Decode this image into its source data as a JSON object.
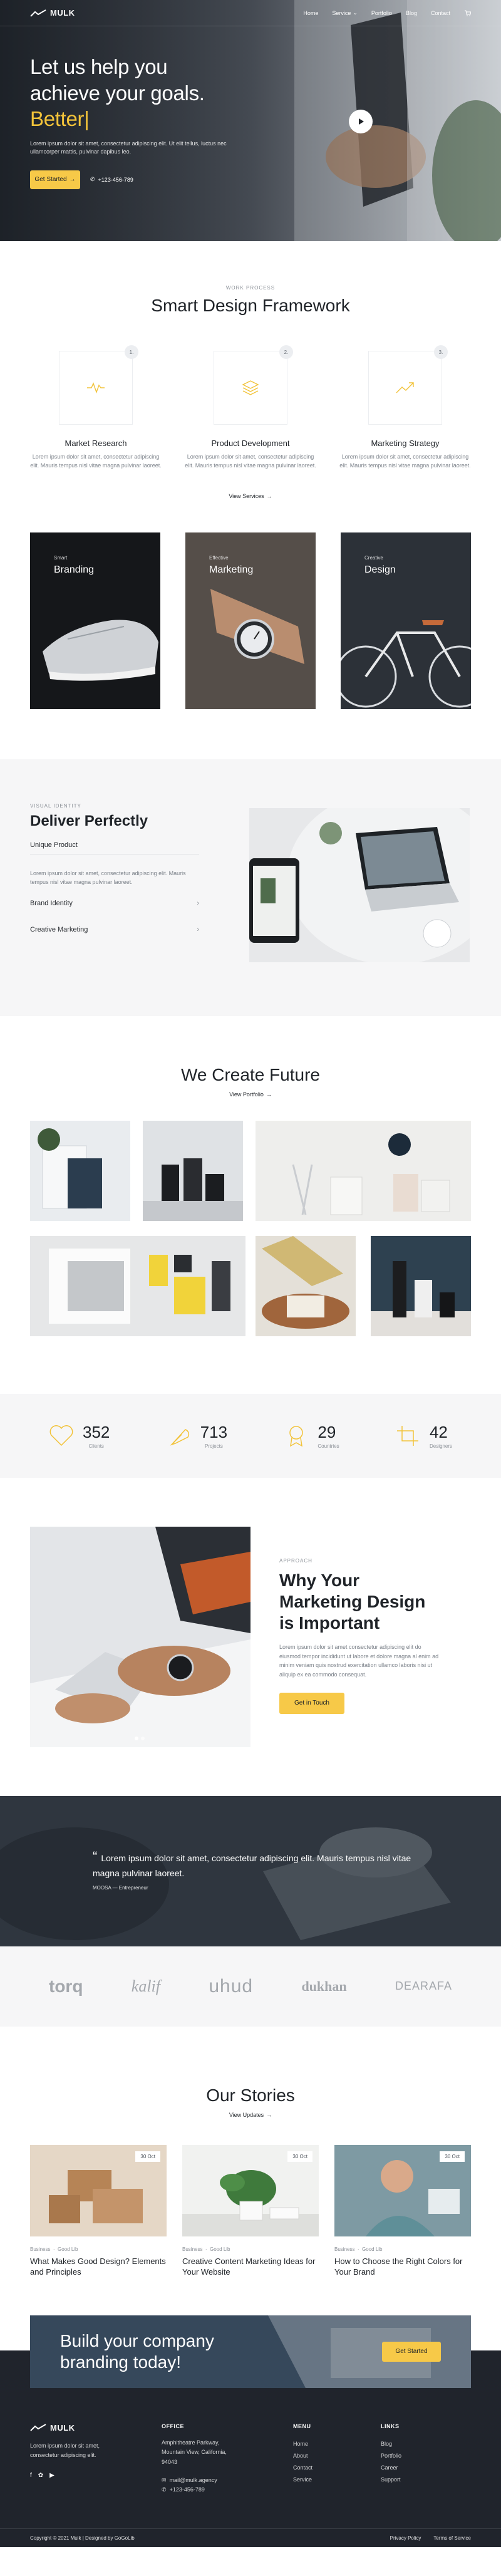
{
  "brand": {
    "name": "MULK"
  },
  "nav": {
    "items": [
      {
        "label": "Home",
        "dropdown": false
      },
      {
        "label": "Service",
        "dropdown": true
      },
      {
        "label": "Portfolio",
        "dropdown": false
      },
      {
        "label": "Blog",
        "dropdown": false
      },
      {
        "label": "Contact",
        "dropdown": false
      }
    ]
  },
  "hero": {
    "title_line1": "Let us help you",
    "title_line2": "achieve your goals.",
    "title_accent": "Better|",
    "subtitle": "Lorem ipsum dolor sit amet, consectetur adipiscing elit. Ut elit tellus, luctus nec ullamcorper mattis, pulvinar dapibus leo.",
    "cta_label": "Get Started",
    "phone": "+123-456-789"
  },
  "process": {
    "eyebrow": "WORK PROCESS",
    "title": "Smart Design Framework",
    "steps": [
      {
        "num": "1.",
        "title": "Market Research",
        "desc": "Lorem ipsum dolor sit amet, consectetur adipiscing elit. Mauris tempus nisl vitae magna pulvinar laoreet."
      },
      {
        "num": "2.",
        "title": "Product Development",
        "desc": "Lorem ipsum dolor sit amet, consectetur adipiscing elit. Mauris tempus nisl vitae magna pulvinar laoreet."
      },
      {
        "num": "3.",
        "title": "Marketing Strategy",
        "desc": "Lorem ipsum dolor sit amet, consectetur adipiscing elit. Mauris tempus nisl vitae magna pulvinar laoreet."
      }
    ],
    "view_link": "View Services"
  },
  "services": [
    {
      "small": "Smart",
      "title": "Branding"
    },
    {
      "small": "Effective",
      "title": "Marketing"
    },
    {
      "small": "Creative",
      "title": "Design"
    }
  ],
  "deliver": {
    "eyebrow": "VISUAL IDENTITY",
    "title": "Deliver Perfectly",
    "open_item": "Unique Product",
    "open_text": "Lorem ipsum dolor sit amet, consectetur adipiscing elit. Mauris tempus nisl vitae magna pulvinar laoreet.",
    "items": [
      "Brand Identity",
      "Creative Marketing"
    ]
  },
  "future": {
    "title": "We Create Future",
    "view_link": "View Portfolio"
  },
  "stats": [
    {
      "value": "352",
      "label": "Clients",
      "icon": "heart-icon"
    },
    {
      "value": "713",
      "label": "Projects",
      "icon": "feather-icon"
    },
    {
      "value": "29",
      "label": "Countries",
      "icon": "award-icon"
    },
    {
      "value": "42",
      "label": "Designers",
      "icon": "crop-icon"
    }
  ],
  "why": {
    "eyebrow": "APPROACH",
    "title_line1": "Why Your",
    "title_line2": "Marketing Design",
    "title_line3": "is Important",
    "body": "Lorem ipsum dolor sit amet consectetur adipiscing elit do eiusmod tempor incididunt ut labore et dolore magna al enim ad minim veniam quis nostrud exercitation ullamco laboris nisi ut aliquip ex ea commodo consequat.",
    "button": "Get in Touch"
  },
  "testimonial": {
    "quote": "Lorem ipsum dolor sit amet, consectetur adipiscing elit. Mauris tempus nisl vitae magna pulvinar laoreet.",
    "author": "MOOSA",
    "role": "Entrepreneur"
  },
  "clients": [
    "torq",
    "kalif",
    "uhud",
    "dukhan",
    "DEARAFA"
  ],
  "stories": {
    "title": "Our Stories",
    "view_link": "View Updates",
    "posts": [
      {
        "date": "30 Oct",
        "category": "Business",
        "author": "Good Lib",
        "title": "What Makes Good Design? Elements and Principles"
      },
      {
        "date": "30 Oct",
        "category": "Business",
        "author": "Good Lib",
        "title": "Creative Content Marketing Ideas for Your Website"
      },
      {
        "date": "30 Oct",
        "category": "Business",
        "author": "Good Lib",
        "title": "How to Choose the Right Colors for Your Brand"
      }
    ]
  },
  "cta": {
    "line1": "Build your company",
    "line2": "branding today!",
    "button": "Get Started"
  },
  "footer": {
    "about": "Lorem ipsum dolor sit amet, consectetur adipiscing elit.",
    "office_heading": "OFFICE",
    "office_address": "Amphitheatre Parkway, Mountain View, California, 94043",
    "email": "mail@mulk.agency",
    "phone": "+123-456-789",
    "menu_heading": "MENU",
    "menu": [
      "Home",
      "About",
      "Contact",
      "Service"
    ],
    "links_heading": "LINKS",
    "links": [
      "Blog",
      "Portfolio",
      "Career",
      "Support"
    ],
    "copyright": "Copyright © 2021 Mulk | Designed by GoGoLib",
    "bottom_links": [
      "Privacy Policy",
      "Terms of Service"
    ]
  }
}
